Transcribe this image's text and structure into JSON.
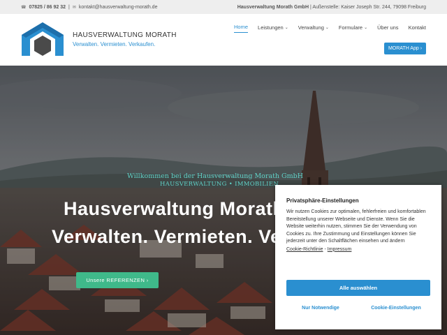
{
  "topbar": {
    "phone": "07825 / 86 92 32",
    "separator": "|",
    "email": "kontakt@hausverwaltung-morath.de",
    "company": "Hausverwaltung Morath GmbH",
    "branch": "| Außenstelle: Kaiser Joseph Str. 244, 79098 Freiburg",
    "phone_icon": "phone-icon",
    "mail_icon": "mail-icon"
  },
  "header": {
    "brand_name": "HAUSVERWALTUNG MORATH",
    "brand_tagline": "Verwalten. Vermieten. Verkaufen.",
    "nav": [
      {
        "label": "Home",
        "active": true,
        "dropdown": false
      },
      {
        "label": "Leistungen",
        "active": false,
        "dropdown": true
      },
      {
        "label": "Verwaltung",
        "active": false,
        "dropdown": true
      },
      {
        "label": "Formulare",
        "active": false,
        "dropdown": true
      },
      {
        "label": "Über uns",
        "active": false,
        "dropdown": false
      },
      {
        "label": "Kontakt",
        "active": false,
        "dropdown": false
      }
    ],
    "app_button": "MORATH App ›",
    "chevron": "⌄"
  },
  "hero": {
    "welcome": "Willkommen bei der Hausverwaltung Morath GmbH",
    "welcome_sub": "HAUSVERWALTUNG • IMMOBILIEN",
    "title_line1": "Hausverwaltung Morath",
    "title_line2": "Verwalten. Vermieten. Verkaufen.",
    "ref_button": "Unsere REFERENZEN ›"
  },
  "cookie": {
    "title": "Privatsphäre-Einstellungen",
    "text": "Wir nutzen Cookies zur optimalen, fehlerfreien und komfortablen Bereitstellung unserer Webseite und Dienste. Wenn Sie die Website weiterhin nutzen, stimmen Sie der Verwendung von Cookies zu. Ihre Zustimmung und Einstellungen können Sie jederzeit unter den Schaltflächen einsehen und ändern",
    "link_policy": "Cookie-Richtlinie",
    "link_sep": " - ",
    "link_imprint": "Impressum",
    "accept_all": "Alle auswählen",
    "only_necessary": "Nur Notwendige",
    "settings": "Cookie-Einstellungen"
  },
  "colors": {
    "accent_blue": "#2a8fd0",
    "accent_green": "#3fb98a",
    "welcome_teal": "#5fd0c6",
    "logo_dark": "#4a4a4a"
  }
}
